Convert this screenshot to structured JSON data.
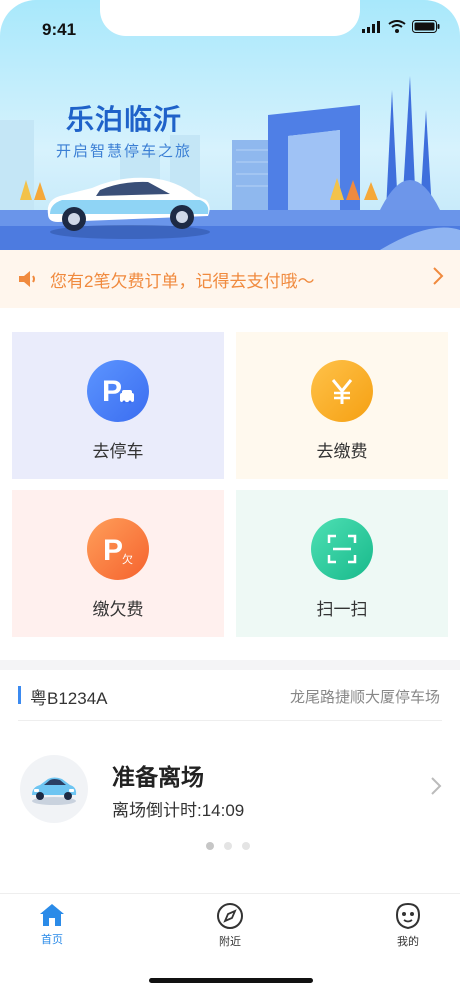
{
  "status_bar": {
    "time": "9:41"
  },
  "banner": {
    "brand": "乐泊临沂",
    "slogan": "开启智慧停车之旅"
  },
  "notice": {
    "text": "您有2笔欠费订单，记得去支付哦～",
    "icon": "speaker-icon"
  },
  "actions": [
    {
      "label": "去停车",
      "icon": "parking-car-icon",
      "color": "#3b6df0"
    },
    {
      "label": "去缴费",
      "icon": "yuan-icon",
      "color": "#f5a012"
    },
    {
      "label": "缴欠费",
      "icon": "parking-owed-icon",
      "glyph": "欠",
      "color": "#f5622e"
    },
    {
      "label": "扫一扫",
      "icon": "scan-icon",
      "color": "#18b98b"
    }
  ],
  "parking": {
    "plate": "粤B1234A",
    "lot": "龙尾路捷顺大厦停车场",
    "status": "准备离场",
    "countdown": "离场倒计时:14:09",
    "page_indicator": {
      "count": 3,
      "active": 1
    }
  },
  "tabbar": {
    "items": [
      {
        "label": "首页",
        "icon": "home-icon",
        "active": true
      },
      {
        "label": "附近",
        "icon": "compass-icon",
        "active": false
      },
      {
        "label": "我的",
        "icon": "profile-icon",
        "active": false
      }
    ]
  },
  "colors": {
    "accent": "#2b8be8",
    "notice": "#f08a3e",
    "brand": "#1f62c9"
  }
}
